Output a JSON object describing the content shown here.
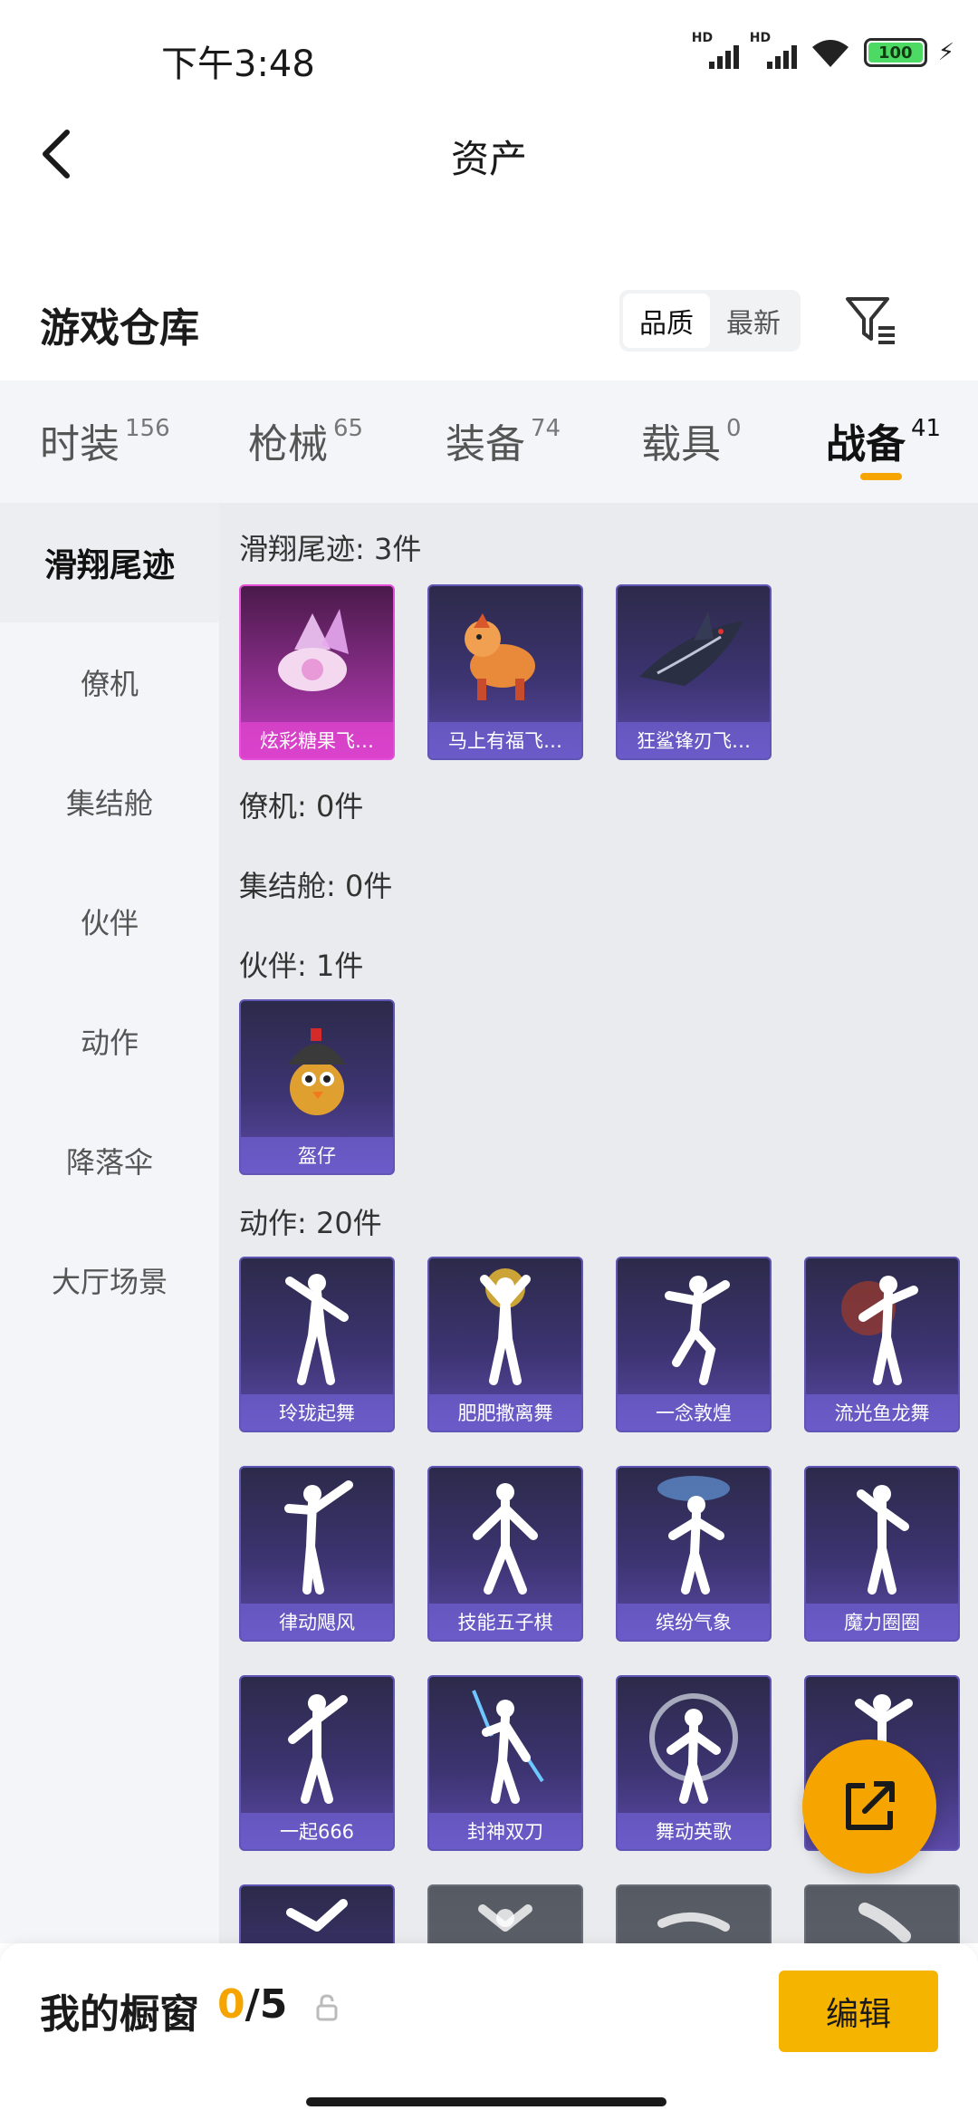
{
  "status_bar": {
    "time": "下午3:48",
    "hd1": "HD",
    "hd2": "HD",
    "battery": "100"
  },
  "nav": {
    "title": "资产"
  },
  "warehouse": {
    "title": "游戏仓库",
    "sort_options": [
      "品质",
      "最新"
    ],
    "sort_selected": "品质"
  },
  "tabs": [
    {
      "label": "时装",
      "count": "156"
    },
    {
      "label": "枪械",
      "count": "65"
    },
    {
      "label": "装备",
      "count": "74"
    },
    {
      "label": "载具",
      "count": "0"
    },
    {
      "label": "战备",
      "count": "41"
    }
  ],
  "active_tab": "战备",
  "sidebar": [
    {
      "label": "滑翔尾迹"
    },
    {
      "label": "僚机"
    },
    {
      "label": "集结舱"
    },
    {
      "label": "伙伴"
    },
    {
      "label": "动作"
    },
    {
      "label": "降落伞"
    },
    {
      "label": "大厅场景"
    }
  ],
  "sections": {
    "glide": {
      "title": "滑翔尾迹: 3件",
      "items": [
        "炫彩糖果飞…",
        "马上有福飞…",
        "狂鲨锋刃飞…"
      ]
    },
    "wingman": {
      "title": "僚机: 0件"
    },
    "pod": {
      "title": "集结舱: 0件"
    },
    "partner": {
      "title": "伙伴: 1件",
      "items": [
        "盔仔"
      ]
    },
    "emote": {
      "title": "动作: 20件",
      "items": [
        "玲珑起舞",
        "肥肥撒离舞",
        "一念敦煌",
        "流光鱼龙舞",
        "律动飓风",
        "技能五子棋",
        "缤纷气象",
        "魔力圈圈",
        "一起666",
        "封神双刀",
        "舞动英歌"
      ]
    }
  },
  "bottom": {
    "title": "我的橱窗",
    "count_current": "0",
    "count_sep_total": "/5",
    "edit_label": "编辑"
  },
  "colors": {
    "accent": "#f5a400",
    "card_purple": "#3d3472",
    "card_pink": "#c23cc2"
  }
}
